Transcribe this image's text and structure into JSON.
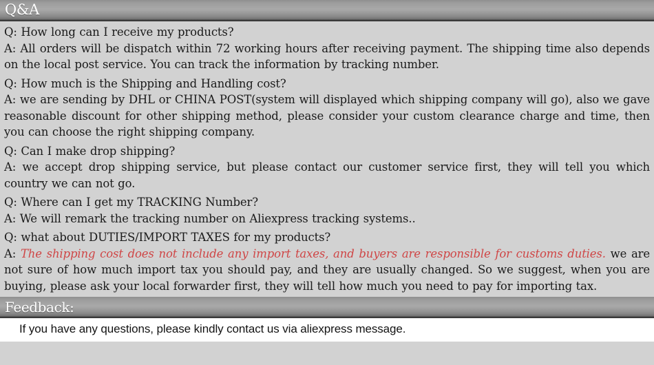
{
  "qa_section": {
    "header_title": "Q&A",
    "blocks": [
      {
        "question": "Q: How long can I receive my products?",
        "answer": "A: All orders will be dispatch within 72 working hours after receiving payment. The shipping time also depends on the local post service. You can track the information by tracking number."
      },
      {
        "question": "Q: How much is the Shipping and Handling cost?",
        "answer": "A: we are sending by DHL or CHINA POST(system will displayed which shipping company will go), also we gave reasonable discount for other shipping method, please consider your custom clearance charge and time, then you can choose the right shipping company."
      },
      {
        "question": "Q: Can I make drop shipping?",
        "answer": "A: we accept drop shipping service, but please contact our customer service first, they will tell you which country we can not go."
      },
      {
        "question": "Q: Where can I get my TRACKING Number?",
        "answer": "A: We will remark the tracking number on Aliexpress tracking systems.."
      }
    ],
    "duties_block": {
      "question": "Q: what about DUTIES/IMPORT TAXES for my products?",
      "answer_prefix": "A: ",
      "answer_highlight": "The shipping cost does not include any import taxes, and buyers are responsible for customs duties.",
      "answer_rest": " we are not sure of how much import tax you should pay, and they are usually changed. So we suggest, when you are buying, please ask your local forwarder first, they will tell how much you need to pay for importing tax."
    }
  },
  "feedback_section": {
    "header_title": "Feedback:",
    "message": "If you have any questions, please kindly contact us via aliexpress message."
  },
  "colors": {
    "highlight_red": "#cf4646",
    "body_background": "#d2d2d2",
    "header_bar_gray": "#9c9c9c",
    "footer_background": "#ffffff",
    "text_black": "#1a1a1a"
  }
}
